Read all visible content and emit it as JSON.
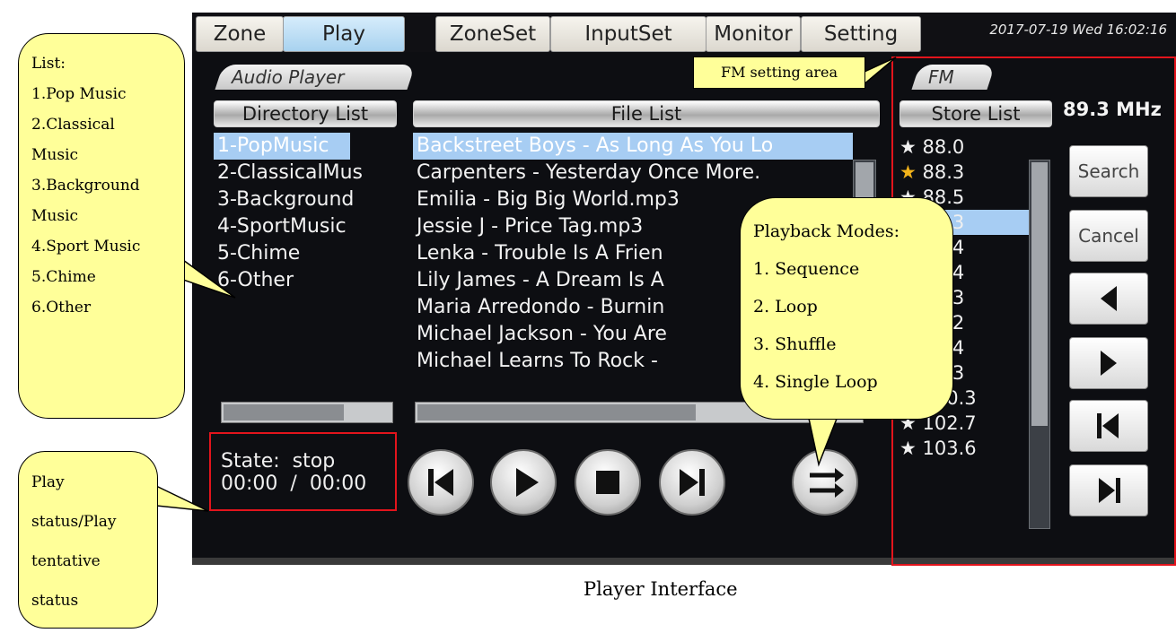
{
  "tabs": [
    "Zone",
    "Play",
    "ZoneSet",
    "InputSet",
    "Monitor",
    "Setting"
  ],
  "active_tab": "Play",
  "datetime": "2017-07-19 Wed 16:02:16",
  "audio_player": {
    "section_label": "Audio Player",
    "directory_header": "Directory List",
    "file_header": "File List",
    "directories": [
      "1-PopMusic",
      "2-ClassicalMus",
      "3-Background",
      "4-SportMusic",
      "5-Chime",
      "6-Other"
    ],
    "selected_directory": "1-PopMusic",
    "files": [
      "Backstreet Boys - As Long As You Lo",
      "Carpenters - Yesterday Once More.",
      "Emilia - Big Big World.mp3",
      "Jessie J - Price Tag.mp3",
      "Lenka - Trouble Is A Frien",
      "Lily James - A Dream Is A",
      "Maria Arredondo - Burnin",
      "Michael Jackson - You Are",
      "Michael Learns To Rock -"
    ],
    "selected_file": "Backstreet Boys - As Long As You Lo",
    "state_label": "State:",
    "state_value": "stop",
    "time_current": "00:00",
    "time_separator": "/",
    "time_total": "00:00"
  },
  "fm": {
    "section_label": "FM",
    "store_list_header": "Store List",
    "frequency_display": "89.3 MHz",
    "stations": [
      {
        "freq": "88.0",
        "star": "white"
      },
      {
        "freq": "88.3",
        "star": "gold"
      },
      {
        "freq": "88.5",
        "star": "white"
      },
      {
        "freq": "89.3",
        "star": "white"
      },
      {
        "freq": "91.4",
        "star": "white"
      },
      {
        "freq": "92.4",
        "star": "white"
      },
      {
        "freq": "95.3",
        "star": "white"
      },
      {
        "freq": "96.2",
        "star": "white"
      },
      {
        "freq": "97.4",
        "star": "white"
      },
      {
        "freq": "99.3",
        "star": "white"
      },
      {
        "freq": "100.3",
        "star": "white"
      },
      {
        "freq": "102.7",
        "star": "white"
      },
      {
        "freq": "103.6",
        "star": "white"
      }
    ],
    "selected_station": "89.3",
    "search_label": "Search",
    "cancel_label": "Cancel"
  },
  "callouts": {
    "list_lines": [
      "List:",
      "1.Pop Music",
      "2.Classical",
      "Music",
      "3.Background",
      "Music",
      "4.Sport Music",
      "5.Chime",
      "6.Other"
    ],
    "fm_area": "FM setting area",
    "playback_lines": [
      "Playback Modes:",
      "1. Sequence",
      "2. Loop",
      "3. Shuffle",
      "4. Single Loop"
    ],
    "status_lines": [
      "Play",
      "status/Play",
      "tentative",
      "status"
    ]
  },
  "caption": "Player Interface",
  "colors": {
    "callout_fill": "#ffff99",
    "highlight_box": "#e2141c",
    "selection": "#a7cdf3",
    "gold_star": "#f2b31b"
  }
}
